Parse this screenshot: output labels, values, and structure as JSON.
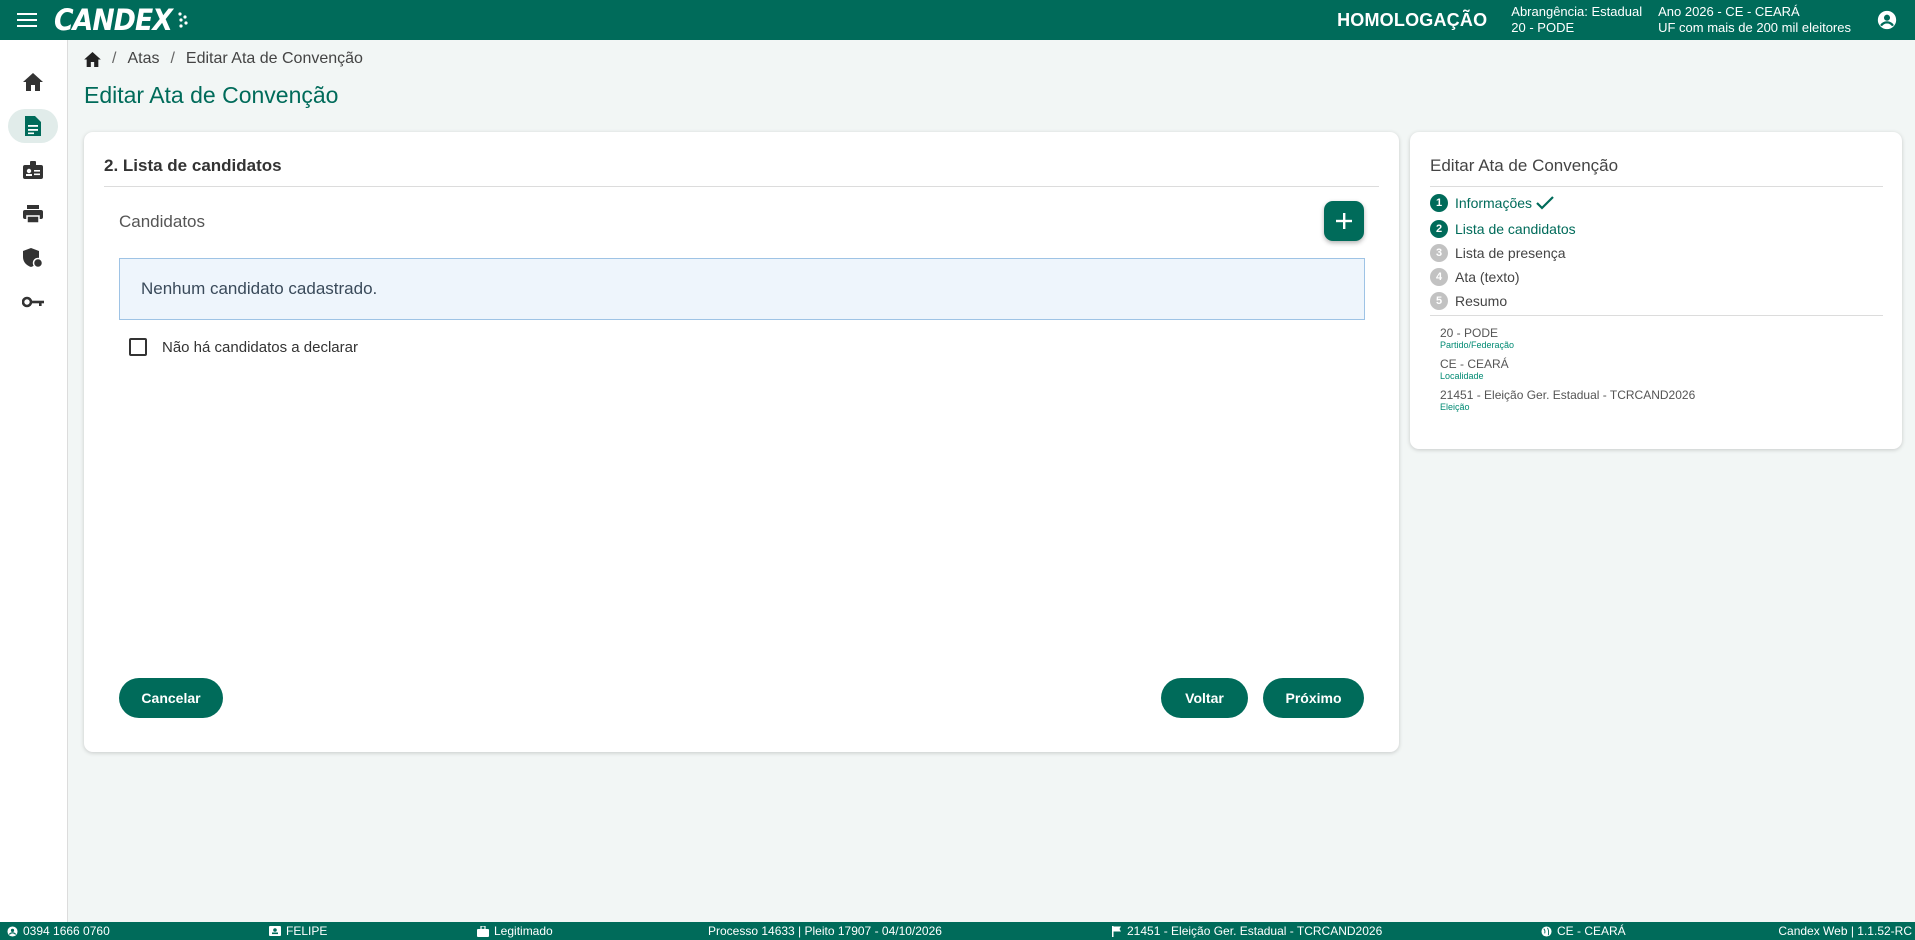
{
  "header": {
    "logo": "CANDEX",
    "environment": "HOMOLOGAÇÃO",
    "scope_line1": "Abrangência: Estadual",
    "scope_line2": "20 - PODE",
    "year_line1": "Ano 2026 - CE - CEARÁ",
    "year_line2": "UF com mais de 200 mil eleitores"
  },
  "breadcrumb": {
    "atas": "Atas",
    "current": "Editar Ata de Convenção"
  },
  "page": {
    "title": "Editar Ata de Convenção"
  },
  "main": {
    "section_title": "2. Lista de candidatos",
    "subsection_title": "Candidatos",
    "empty_message": "Nenhum candidato cadastrado.",
    "no_candidates_label": "Não há candidatos a declarar",
    "no_candidates_checked": false,
    "cancel_label": "Cancelar",
    "back_label": "Voltar",
    "next_label": "Próximo"
  },
  "stepper": {
    "title": "Editar Ata de Convenção",
    "steps": [
      {
        "number": "1",
        "label": "Informações",
        "status": "done"
      },
      {
        "number": "2",
        "label": "Lista de candidatos",
        "status": "current"
      },
      {
        "number": "3",
        "label": "Lista de presença",
        "status": "pending"
      },
      {
        "number": "4",
        "label": "Ata (texto)",
        "status": "pending"
      },
      {
        "number": "5",
        "label": "Resumo",
        "status": "pending"
      }
    ]
  },
  "info": {
    "party_value": "20 - PODE",
    "party_label": "Partido/Federação",
    "location_value": "CE - CEARÁ",
    "location_label": "Localidade",
    "election_value": "21451 - Eleição Ger. Estadual - TCRCAND2026",
    "election_label": "Eleição"
  },
  "footer": {
    "user_id": "0394 1666 0760",
    "user_name": "FELIPE",
    "role": "Legitimado",
    "process": "Processo 14633 | Pleito 17907 - 04/10/2026",
    "election": "21451 - Eleição Ger. Estadual - TCRCAND2026",
    "location": "CE - CEARÁ",
    "version": "Candex Web | 1.1.52-RC"
  },
  "colors": {
    "primary": "#006b5a",
    "alert_bg": "#eef5fc",
    "alert_border": "#9ec3e5",
    "step_pending": "#c2c2c2"
  }
}
